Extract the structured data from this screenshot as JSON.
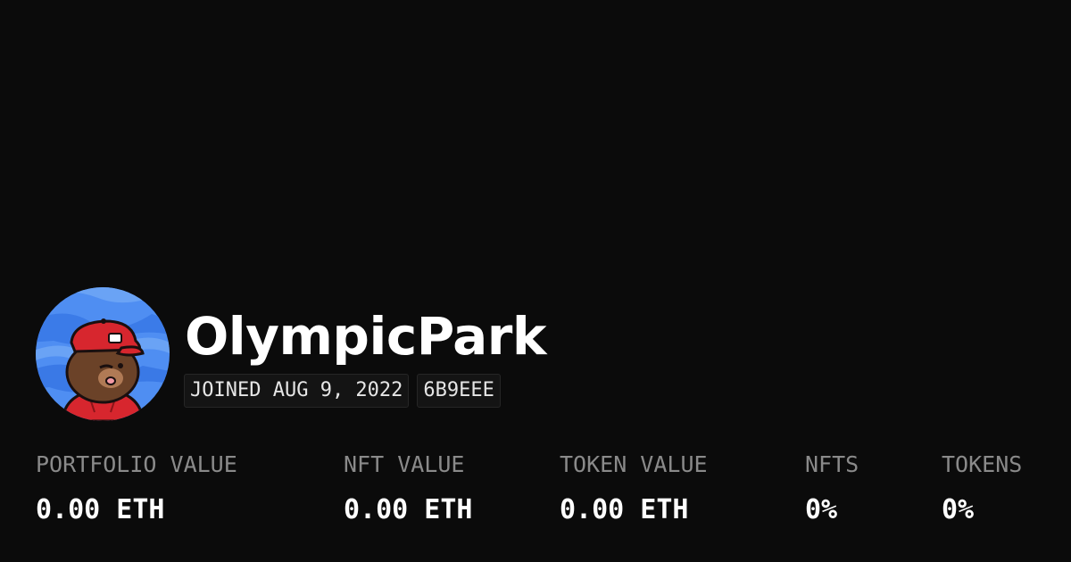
{
  "profile": {
    "username": "OlympicPark",
    "joined": "JOINED AUG 9, 2022",
    "address_tag": "6B9EEE",
    "avatar_icon": "cartoon-mole-red-cap-avatar"
  },
  "stats": [
    {
      "label": "PORTFOLIO VALUE",
      "value": "0.00 ETH"
    },
    {
      "label": "NFT VALUE",
      "value": "0.00 ETH"
    },
    {
      "label": "TOKEN VALUE",
      "value": "0.00 ETH"
    },
    {
      "label": "NFTS",
      "value": "0%"
    },
    {
      "label": "TOKENS",
      "value": "0%"
    }
  ],
  "colors": {
    "background": "#0b0b0b",
    "text_primary": "#ffffff",
    "text_muted": "#8a8a8a",
    "tag_background": "#141414",
    "avatar_sky": "#4f8ef2",
    "cap_red": "#d7262e"
  }
}
